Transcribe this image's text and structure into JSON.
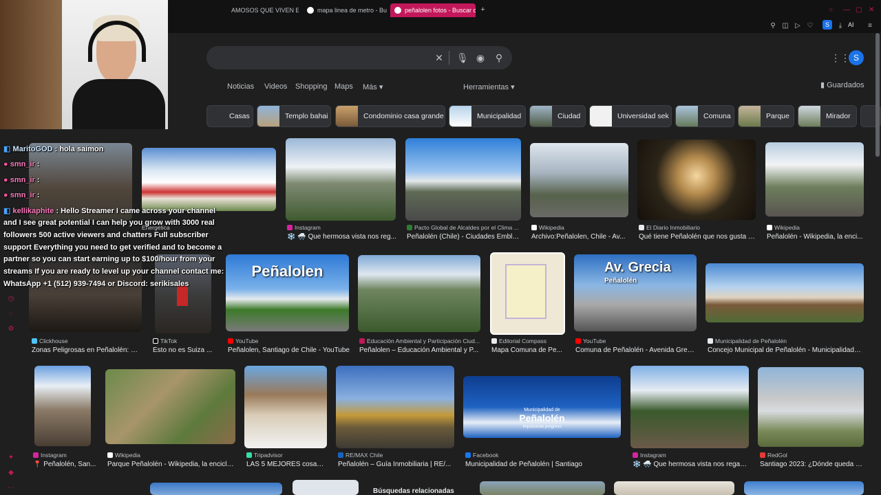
{
  "browser": {
    "tabs": [
      {
        "label": "AMOSOS QUE VIVEN EN"
      },
      {
        "label": "mapa linea de metro - Bu"
      },
      {
        "label": "peñalolen fotos - Buscar c"
      }
    ],
    "profile_letter": "S",
    "ai_label": "AI",
    "accent": "#c2185b"
  },
  "search": {
    "query": "",
    "account_letter": "S"
  },
  "nav": {
    "tabs": [
      {
        "label": "Noticias"
      },
      {
        "label": "Videos"
      },
      {
        "label": "Shopping"
      },
      {
        "label": "Maps"
      },
      {
        "label": "Más"
      }
    ],
    "tools_label": "Herramientas",
    "saved_label": "Guardados"
  },
  "chips": [
    {
      "label": "Casas"
    },
    {
      "label": "Templo bahai"
    },
    {
      "label": "Condominio casa grande"
    },
    {
      "label": "Municipalidad"
    },
    {
      "label": "Ciudad"
    },
    {
      "label": "Universidad sek"
    },
    {
      "label": "Comuna"
    },
    {
      "label": "Parque"
    },
    {
      "label": "Mirador"
    }
  ],
  "results": [
    {
      "source": "Instagram",
      "title": "❄️ 🌨️ Que hermosa vista nos reg..."
    },
    {
      "source": "Pacto Global de Alcaldes por el Clima ...",
      "title": "Peñalolén (Chile) - Ciudades Emble..."
    },
    {
      "source": "Wikipedia",
      "title": "Archivo:Peñalolen, Chile - Av..."
    },
    {
      "source": "El Diario Inmobiliario",
      "title": "Qué tiene Peñalolén que nos gusta t..."
    },
    {
      "source": "Wikipedia",
      "title": "Peñalolén - Wikipedia, la enci..."
    },
    {
      "source": "Clickhouse",
      "title": "Zonas Peligrosas en Peñalolén: S..."
    },
    {
      "source": "TikTok",
      "title": "Esto no es Suiza ..."
    },
    {
      "source": "YouTube",
      "title": "Peñalolen, Santiago de Chile - YouTube"
    },
    {
      "source": "Educación Ambiental y Participación Ciud...",
      "title": "Peñalolen – Educación Ambiental y P..."
    },
    {
      "source": "Editorial Compass",
      "title": "Mapa Comuna de Pe..."
    },
    {
      "source": "YouTube",
      "title": "Comuna de Peñalolén - Avenida Greci..."
    },
    {
      "source": "Municipalidad de Peñalolén",
      "title": "Concejo Municipal de Peñalolén - Municipalidad d..."
    },
    {
      "source": "Instagram",
      "title": "📍 Peñalolén, San..."
    },
    {
      "source": "Wikipedia",
      "title": "Parque Peñalolén - Wikipedia, la enciclo..."
    },
    {
      "source": "Tripadvisor",
      "title": "LAS 5 MEJORES cosas..."
    },
    {
      "source": "RE/MAX Chile",
      "title": "Peñalolén – Guía Inmobiliaria | RE/..."
    },
    {
      "source": "Facebook",
      "title": "Municipalidad de Peñalolén | Santiago"
    },
    {
      "source": "Instagram",
      "title": "❄️ 🌨️ Que hermosa vista nos regala..."
    },
    {
      "source": "RedGol",
      "title": "Santiago 2023: ¿Dónde queda e..."
    }
  ],
  "image_overlays": {
    "youtube_title": "Peñalolen",
    "grecia_title": "Av. Grecia",
    "grecia_sub": "Peñalolén",
    "muni_sub": "Municipalidad de",
    "muni_title": "Peñalolén",
    "muni_slogan": "Impulsando progreso"
  },
  "chat": {
    "messages": [
      {
        "user": "MaritoGOD",
        "text": ": hola saimon"
      },
      {
        "user": "smn_ir",
        "text": ":"
      },
      {
        "user": "smn_ir",
        "text": ":"
      },
      {
        "user": "smn_ir",
        "text": ":"
      },
      {
        "user": "kellikaphite",
        "text": ": Hello Streamer I came across your channel"
      }
    ],
    "long_message": "and I see great potential I can help you grow with 3000 real followers 500 active viewers and chatters Full subscriber support Everything you need to get verified and to become a partner so you can start earning up to $100/hour from your streams If you are ready to level up your channel contact me: WhatsApp +1 (512) 939-7494 or Discord: serikisales"
  },
  "partial_labels": {
    "energetica": "Energética",
    "related": "Búsquedas relacionadas"
  }
}
